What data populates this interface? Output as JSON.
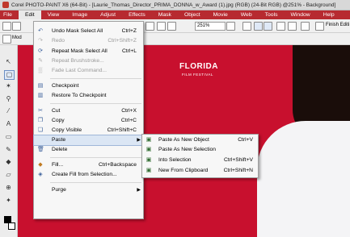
{
  "window": {
    "title": "Corel PHOTO-PAINT X6 (64-Bit) - [Laurie_Thomas_Director_PRIMA_DONNA_w_Award (1).jpg (RGB) (24-Bit RGB) @251% - Background]"
  },
  "menubar": {
    "items": [
      "File",
      "Edit",
      "View",
      "Image",
      "Adjust",
      "Effects",
      "Mask",
      "Object",
      "Movie",
      "Web",
      "Tools",
      "Window",
      "Help"
    ],
    "active": "Edit"
  },
  "toolbar": {
    "zoom": "251%",
    "finish_label": "Finish Editi",
    "mode_label": "Mod"
  },
  "canvas": {
    "logo_title": "FLORIDA",
    "logo_subtitle": "FILM FESTIVAL",
    "background_color": "#c8102e"
  },
  "edit_menu": {
    "items": [
      {
        "label": "Undo Mask Select All",
        "shortcut": "Ctrl+Z",
        "icon": "undo-icon",
        "enabled": true
      },
      {
        "label": "Redo",
        "shortcut": "Ctrl+Shift+Z",
        "icon": "redo-icon",
        "enabled": false
      },
      {
        "label": "Repeat Mask Select All",
        "shortcut": "Ctrl+L",
        "icon": "repeat-icon",
        "enabled": true
      },
      {
        "label": "Repeat Brushstroke...",
        "shortcut": "",
        "icon": "brush-icon",
        "enabled": false
      },
      {
        "label": "Fade Last Command...",
        "shortcut": "",
        "icon": "fade-icon",
        "enabled": false
      },
      {
        "label": "Checkpoint",
        "shortcut": "",
        "icon": "checkpoint-icon",
        "enabled": true
      },
      {
        "label": "Restore To Checkpoint",
        "shortcut": "",
        "icon": "restore-icon",
        "enabled": true
      },
      {
        "label": "Cut",
        "shortcut": "Ctrl+X",
        "icon": "scissors-icon",
        "enabled": true
      },
      {
        "label": "Copy",
        "shortcut": "Ctrl+C",
        "icon": "copy-icon",
        "enabled": true
      },
      {
        "label": "Copy Visible",
        "shortcut": "Ctrl+Shift+C",
        "icon": "copy-visible-icon",
        "enabled": true
      },
      {
        "label": "Paste",
        "shortcut": "",
        "icon": "",
        "enabled": true,
        "submenu": true
      },
      {
        "label": "Delete",
        "shortcut": "",
        "icon": "trash-icon",
        "enabled": true
      },
      {
        "label": "Fill...",
        "shortcut": "Ctrl+Backspace",
        "icon": "fill-icon",
        "enabled": true
      },
      {
        "label": "Create Fill from Selection...",
        "shortcut": "",
        "icon": "create-fill-icon",
        "enabled": true
      },
      {
        "label": "Purge",
        "shortcut": "",
        "icon": "",
        "enabled": true,
        "submenu": true
      }
    ]
  },
  "paste_submenu": {
    "items": [
      {
        "label": "Paste As New Object",
        "shortcut": "Ctrl+V",
        "icon": "paste-object-icon"
      },
      {
        "label": "Paste As New Selection",
        "shortcut": "",
        "icon": "paste-selection-icon"
      },
      {
        "label": "Into Selection",
        "shortcut": "Ctrl+Shift+V",
        "icon": "paste-into-icon"
      },
      {
        "label": "New From Clipboard",
        "shortcut": "Ctrl+Shift+N",
        "icon": "new-from-clipboard-icon"
      }
    ]
  }
}
